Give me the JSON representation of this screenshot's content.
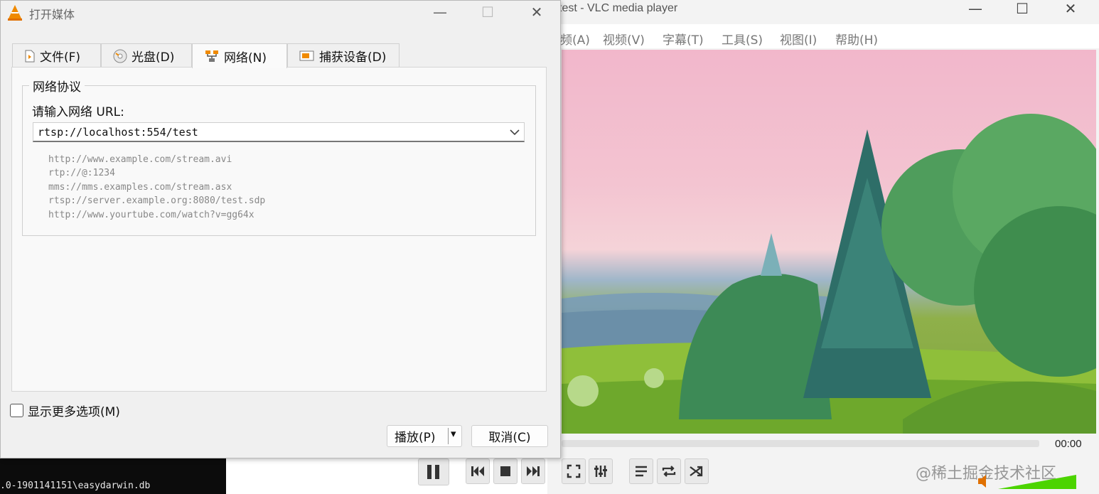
{
  "terminal": {
    "line": ".0-1901141151\\easydarwin.db"
  },
  "vlc": {
    "title": "test - VLC media player",
    "window_controls": {
      "minimize": "—",
      "maximize": "☐",
      "close": "✕"
    },
    "menu": [
      "频(A)",
      "视频(V)",
      "字幕(T)",
      "工具(S)",
      "视图(I)",
      "帮助(H)"
    ],
    "time": "00:00",
    "watermark": "@稀土掘金技术社区",
    "icons": [
      "pause-icon",
      "previous-icon",
      "stop-icon",
      "next-icon",
      "fullscreen-icon",
      "extended-settings-icon",
      "playlist-icon",
      "loop-icon",
      "shuffle-icon",
      "volume-icon"
    ]
  },
  "dialog": {
    "title": "打开媒体",
    "window_controls": {
      "minimize": "—",
      "maximize": "☐",
      "close": "✕"
    },
    "tabs": [
      {
        "label": "文件(F)",
        "icon": "file-icon"
      },
      {
        "label": "光盘(D)",
        "icon": "disc-icon"
      },
      {
        "label": "网络(N)",
        "icon": "network-icon",
        "active": true
      },
      {
        "label": "捕获设备(D)",
        "icon": "capture-device-icon"
      }
    ],
    "group_title": "网络协议",
    "url_label": "请输入网络 URL:",
    "url_value": "rtsp://localhost:554/test",
    "examples": [
      "http://www.example.com/stream.avi",
      "rtp://@:1234",
      "mms://mms.examples.com/stream.asx",
      "rtsp://server.example.org:8080/test.sdp",
      "http://www.yourtube.com/watch?v=gg64x"
    ],
    "more_options_label": "显示更多选项(M)",
    "play_button": "播放(P)",
    "play_dropdown": "▾",
    "cancel_button": "取消(C)"
  },
  "colors": {
    "accent": "#f08a00",
    "dialog_bg": "#f0f0f0",
    "panel_bg": "#f9f9f9",
    "volume_green": "#4cd400"
  }
}
